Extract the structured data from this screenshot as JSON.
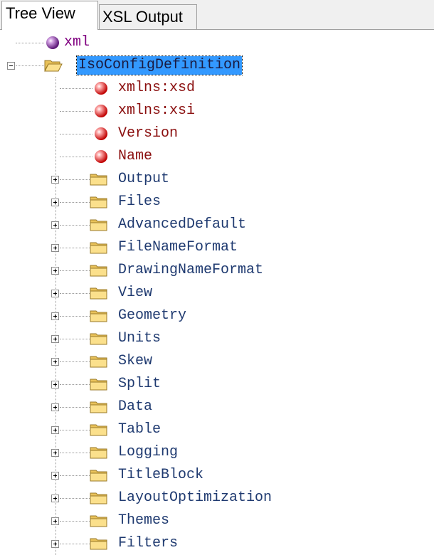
{
  "tabs": [
    {
      "label": "Tree View",
      "active": true
    },
    {
      "label": "XSL Output",
      "active": false
    }
  ],
  "tree": {
    "pi": {
      "label": "xml",
      "icon": "purple-ball-icon"
    },
    "root": {
      "label": "IsoConfigDefinition",
      "icon": "open-folder-icon",
      "expanded": true,
      "selected": true
    },
    "attributes": [
      {
        "label": "xmlns:xsd",
        "icon": "red-ball-icon"
      },
      {
        "label": "xmlns:xsi",
        "icon": "red-ball-icon"
      },
      {
        "label": "Version",
        "icon": "red-ball-icon"
      },
      {
        "label": "Name",
        "icon": "red-ball-icon"
      }
    ],
    "children": [
      {
        "label": "Output"
      },
      {
        "label": "Files"
      },
      {
        "label": "AdvancedDefault"
      },
      {
        "label": "FileNameFormat"
      },
      {
        "label": "DrawingNameFormat"
      },
      {
        "label": "View"
      },
      {
        "label": "Geometry"
      },
      {
        "label": "Units"
      },
      {
        "label": "Skew"
      },
      {
        "label": "Split"
      },
      {
        "label": "Data"
      },
      {
        "label": "Table"
      },
      {
        "label": "Logging"
      },
      {
        "label": "TitleBlock"
      },
      {
        "label": "LayoutOptimization"
      },
      {
        "label": "Themes"
      },
      {
        "label": "Filters"
      }
    ]
  },
  "colors": {
    "selection": "#3399ff",
    "element_text": "#1f3a70",
    "attribute_text": "#8b1010",
    "pi_text": "#800080",
    "folder": "#f3d27a"
  }
}
